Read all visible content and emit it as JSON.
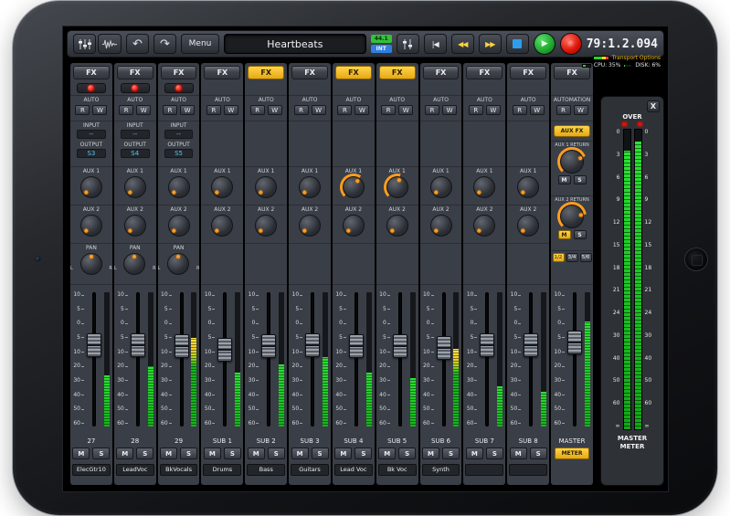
{
  "toolbar": {
    "menu": "Menu",
    "title": "Heartbeats",
    "rate_badge": "44.1",
    "sync_badge": "INT",
    "timecode": "79:1.2.094",
    "transport_options": "Transport Options",
    "cpu_label": "CPU:",
    "cpu_value": "35%",
    "disk_label": "DISK:",
    "disk_value": "6%"
  },
  "labels": {
    "fx": "FX",
    "auto": "AUTO",
    "automation": "AUTOMATION",
    "read": "R",
    "write": "W",
    "input": "INPUT",
    "output": "OUTPUT",
    "aux1": "AUX 1",
    "aux2": "AUX 2",
    "pan": "PAN",
    "pan_left": "L",
    "pan_right": "R",
    "mute": "M",
    "solo": "S",
    "aux_fx": "AUX FX",
    "aux1_return": "AUX 1 RETURN",
    "aux2_return": "AUX 2 RETURN",
    "pair_12": "1/2",
    "pair_34": "3/4",
    "pair_56": "5/6",
    "meter_btn": "METER"
  },
  "fader_scale": [
    "10",
    "5",
    "0",
    "5",
    "10",
    "20",
    "30",
    "40",
    "50",
    "60"
  ],
  "master_meter": {
    "close": "X",
    "over": "OVER",
    "scale": [
      "0",
      "3",
      "6",
      "9",
      "12",
      "15",
      "18",
      "21",
      "24",
      "30",
      "40",
      "50",
      "60",
      "∞"
    ],
    "title_line1": "MASTER",
    "title_line2": "METER",
    "left_level": 93,
    "right_level": 96
  },
  "channels": [
    {
      "num": "27",
      "name": "ElecGtr10",
      "type": "track",
      "fx_on": false,
      "armed": true,
      "input_value": "--",
      "output_value": "S3",
      "aux1": 0,
      "aux2": 0,
      "pan": 0.5,
      "fader": 32,
      "meter": 38,
      "hot": false
    },
    {
      "num": "28",
      "name": "LeadVoc",
      "type": "track",
      "fx_on": false,
      "armed": true,
      "input_value": "--",
      "output_value": "S4",
      "aux1": 0,
      "aux2": 0,
      "pan": 0.5,
      "fader": 32,
      "meter": 45,
      "hot": false
    },
    {
      "num": "29",
      "name": "BkVocals",
      "type": "track",
      "fx_on": false,
      "armed": true,
      "input_value": "--",
      "output_value": "S5",
      "aux1": 0,
      "aux2": 0,
      "pan": 0.5,
      "fader": 33,
      "meter": 66,
      "hot": true
    },
    {
      "num": "SUB 1",
      "name": "Drums",
      "type": "sub",
      "fx_on": false,
      "armed": false,
      "input_value": null,
      "output_value": null,
      "aux1": 0,
      "aux2": 0,
      "pan": null,
      "fader": 35,
      "meter": 40,
      "hot": false
    },
    {
      "num": "SUB 2",
      "name": "Bass",
      "type": "sub",
      "fx_on": true,
      "armed": false,
      "input_value": null,
      "output_value": null,
      "aux1": 0,
      "aux2": 0,
      "pan": null,
      "fader": 33,
      "meter": 46,
      "hot": false
    },
    {
      "num": "SUB 3",
      "name": "Guitars",
      "type": "sub",
      "fx_on": false,
      "armed": false,
      "input_value": null,
      "output_value": null,
      "aux1": 0,
      "aux2": 0,
      "pan": null,
      "fader": 32,
      "meter": 52,
      "hot": false
    },
    {
      "num": "SUB 4",
      "name": "Lead Voc",
      "type": "sub",
      "fx_on": true,
      "armed": false,
      "input_value": null,
      "output_value": null,
      "aux1": 0.62,
      "aux2": 0,
      "pan": null,
      "fader": 33,
      "meter": 40,
      "hot": false
    },
    {
      "num": "SUB 5",
      "name": "Bk Voc",
      "type": "sub",
      "fx_on": true,
      "armed": false,
      "input_value": null,
      "output_value": null,
      "aux1": 0.55,
      "aux2": 0,
      "pan": null,
      "fader": 33,
      "meter": 36,
      "hot": false
    },
    {
      "num": "SUB 6",
      "name": "Synth",
      "type": "sub",
      "fx_on": false,
      "armed": false,
      "input_value": null,
      "output_value": null,
      "aux1": 0,
      "aux2": 0,
      "pan": null,
      "fader": 34,
      "meter": 58,
      "hot": true
    },
    {
      "num": "SUB 7",
      "name": "",
      "type": "sub",
      "fx_on": false,
      "armed": false,
      "input_value": null,
      "output_value": null,
      "aux1": 0,
      "aux2": 0,
      "pan": null,
      "fader": 32,
      "meter": 30,
      "hot": false
    },
    {
      "num": "SUB 8",
      "name": "",
      "type": "sub",
      "fx_on": false,
      "armed": false,
      "input_value": null,
      "output_value": null,
      "aux1": 0,
      "aux2": 0,
      "pan": null,
      "fader": 32,
      "meter": 26,
      "hot": false
    },
    {
      "num": "MASTER",
      "name": "",
      "type": "master",
      "fx_on": false,
      "armed": false,
      "input_value": null,
      "output_value": null,
      "aux1": 0.75,
      "aux2": 0.8,
      "pan": null,
      "fader": 30,
      "meter": 78,
      "hot": false
    }
  ]
}
